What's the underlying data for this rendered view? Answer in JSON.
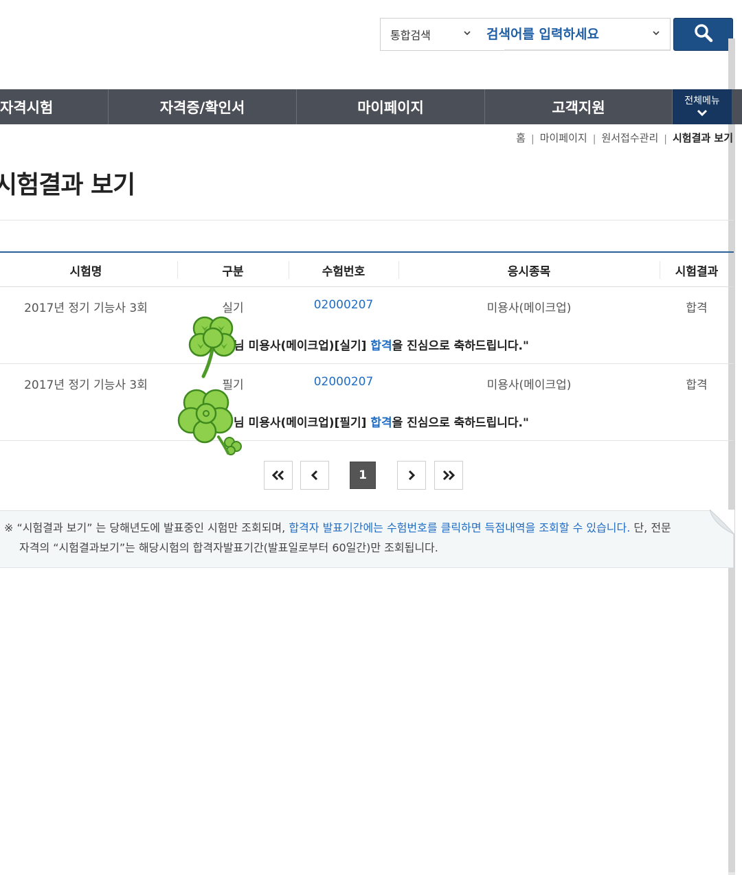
{
  "search": {
    "category": "통합검색",
    "placeholder": "검색어를 입력하세요"
  },
  "nav": {
    "items": [
      {
        "label": "자격시험"
      },
      {
        "label": "자격증/확인서"
      },
      {
        "label": "마이페이지"
      },
      {
        "label": "고객지원"
      }
    ],
    "all_menu": "전체메뉴"
  },
  "breadcrumb": [
    "홈",
    "마이페이지",
    "원서접수관리",
    "시험결과 보기"
  ],
  "page_title": "시험결과 보기",
  "table": {
    "headers": [
      "시험명",
      "구분",
      "수험번호",
      "응시종목",
      "시험결과"
    ],
    "rows": [
      {
        "exam_name": "2017년 정기 기능사 3회",
        "type": "실기",
        "exam_number": "02000207",
        "subject": "미용사(메이크업)",
        "result": "합격",
        "msg_prefix": "님 미용사(메이크업)[실기] ",
        "msg_highlight": "합격",
        "msg_suffix": "을 진심으로 축하드립니다.\""
      },
      {
        "exam_name": "2017년 정기 기능사 3회",
        "type": "필기",
        "exam_number": "02000207",
        "subject": "미용사(메이크업)",
        "result": "합격",
        "msg_prefix": "님 미용사(메이크업)[필기] ",
        "msg_highlight": "합격",
        "msg_suffix": "을 진심으로 축하드립니다.\""
      }
    ]
  },
  "pagination": {
    "first": "«",
    "prev": "‹",
    "current": "1",
    "next": "›",
    "last": "»"
  },
  "notice": {
    "mark": "※",
    "part1": "“시험결과 보기” 는 당해년도에 발표중인 시험만 조회되며, ",
    "part2_highlight": "합격자 발표기간에는 수험번호를 클릭하면 득점내역을 조회할 수 있습니다.",
    "part3": " 단, 전문",
    "line2": "자격의 “시험결과보기”는 해당시험의 합격자발표기간(발표일로부터 60일간)만 조회됩니다."
  },
  "colors": {
    "nav_bg": "#4b4f57",
    "nav_all_bg": "#16365f",
    "search_btn": "#1d4f87",
    "link_blue": "#1f6cc4",
    "table_top_border": "#2d5f99",
    "clover_green": "#7cc63f"
  },
  "icons": {
    "search_button": "magnifier-icon",
    "sticker": "four-leaf-clover-icon"
  }
}
